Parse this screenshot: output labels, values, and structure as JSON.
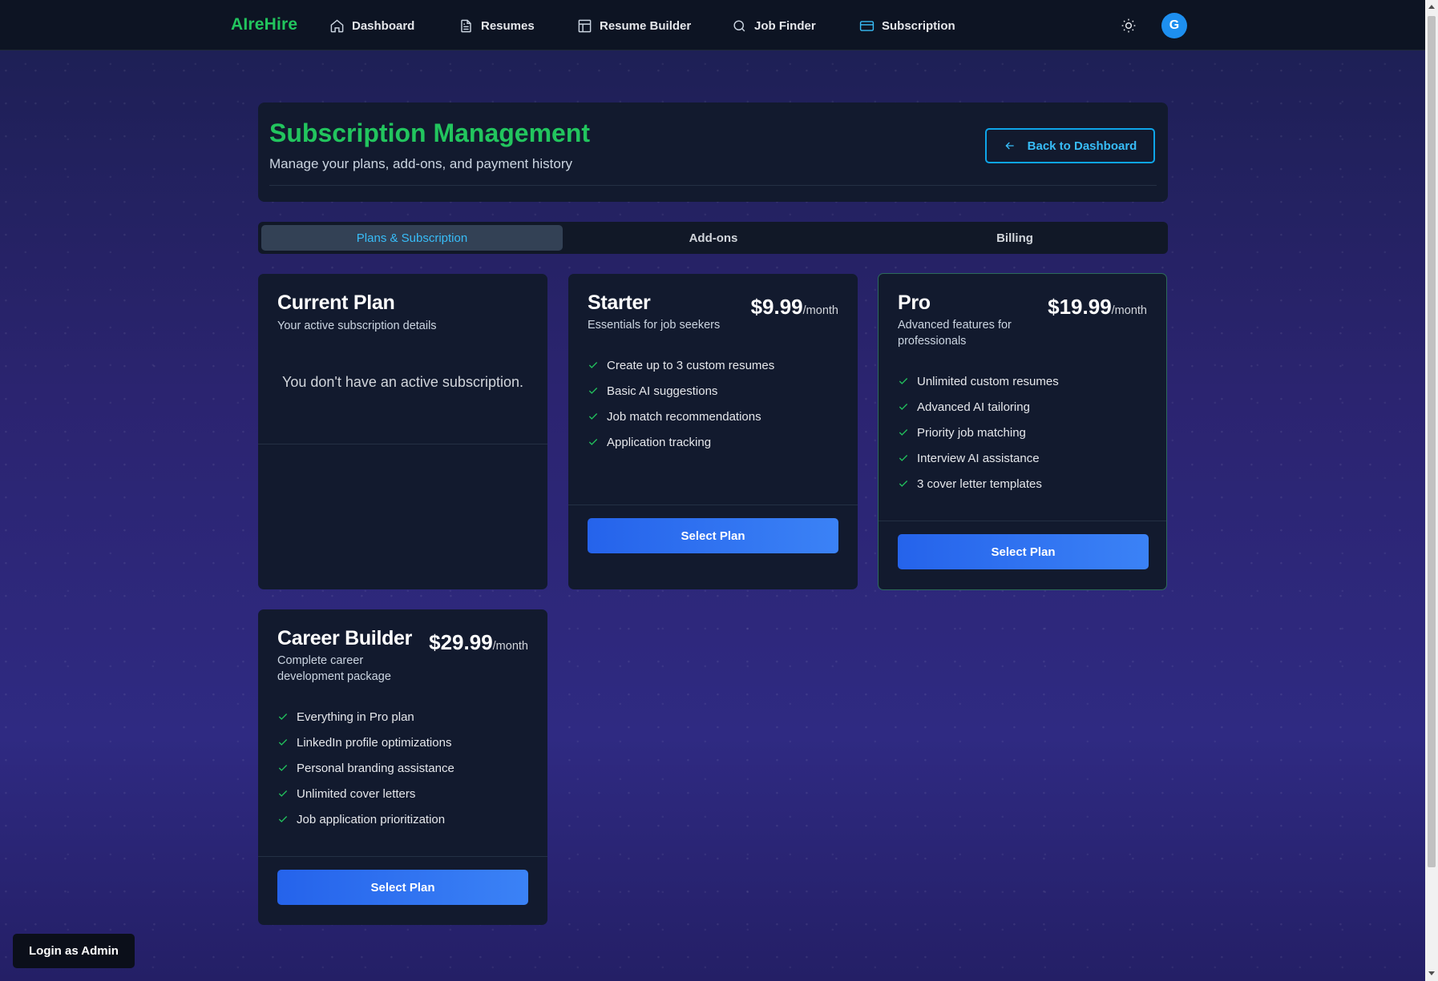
{
  "nav": {
    "brand": "AIreHire",
    "items": [
      {
        "label": "Dashboard",
        "icon": "home-icon"
      },
      {
        "label": "Resumes",
        "icon": "document-icon"
      },
      {
        "label": "Resume Builder",
        "icon": "layout-icon"
      },
      {
        "label": "Job Finder",
        "icon": "search-icon"
      },
      {
        "label": "Subscription",
        "icon": "credit-card-icon",
        "active": true
      }
    ],
    "theme_icon": "sun-icon",
    "avatar_initial": "G"
  },
  "header": {
    "title": "Subscription Management",
    "subtitle": "Manage your plans, add-ons, and payment history",
    "back_label": "Back to Dashboard"
  },
  "tabs": [
    {
      "label": "Plans & Subscription",
      "active": true
    },
    {
      "label": "Add-ons"
    },
    {
      "label": "Billing"
    }
  ],
  "current_plan": {
    "title": "Current Plan",
    "subtitle": "Your active subscription details",
    "empty_message": "You don't have an active subscription."
  },
  "plans": [
    {
      "name": "Starter",
      "description": "Essentials for job seekers",
      "price": "$9.99",
      "period": "/month",
      "features": [
        "Create up to 3 custom resumes",
        "Basic AI suggestions",
        "Job match recommendations",
        "Application tracking"
      ],
      "button": "Select Plan"
    },
    {
      "name": "Pro",
      "description": "Advanced features for professionals",
      "price": "$19.99",
      "period": "/month",
      "features": [
        "Unlimited custom resumes",
        "Advanced AI tailoring",
        "Priority job matching",
        "Interview AI assistance",
        "3 cover letter templates"
      ],
      "button": "Select Plan"
    },
    {
      "name": "Career Builder",
      "description": "Complete career development package",
      "price": "$29.99",
      "period": "/month",
      "features": [
        "Everything in Pro plan",
        "LinkedIn profile optimizations",
        "Personal branding assistance",
        "Unlimited cover letters",
        "Job application prioritization"
      ],
      "button": "Select Plan"
    }
  ],
  "admin_button": "Login as Admin",
  "colors": {
    "accent_green": "#22c55e",
    "accent_blue": "#38bdf8",
    "button_blue": "#2563eb",
    "card_bg": "#121a2e",
    "nav_bg": "#0d1423"
  }
}
